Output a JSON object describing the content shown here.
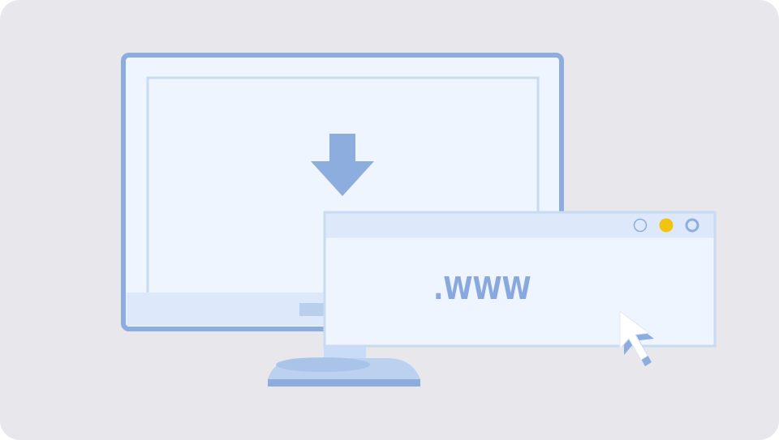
{
  "illustration": {
    "background_color": "#e8e7ec",
    "accent_color": "#8eaddf",
    "screen_color": "#eef5ff",
    "browser_dots": [
      "empty-circle",
      "yellow-dot",
      "ring"
    ],
    "dot_colors": [
      "#8eaddf",
      "#f1c40f",
      "#8eaddf"
    ],
    "download_icon": "down-arrow-icon",
    "cursor_icon": "mouse-pointer-icon"
  },
  "browser": {
    "address_text": ".WWW"
  }
}
